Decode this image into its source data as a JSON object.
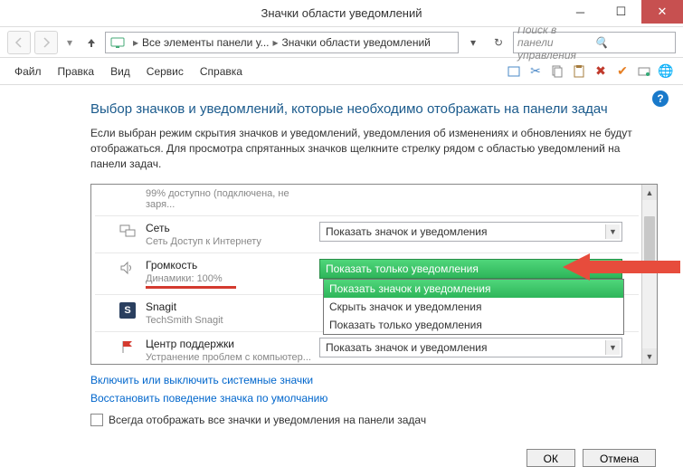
{
  "title": "Значки области уведомлений",
  "nav": {
    "breadcrumb": {
      "part1": "Все элементы панели у...",
      "part2": "Значки области уведомлений"
    },
    "search_placeholder": "Поиск в панели управления"
  },
  "menu": {
    "file": "Файл",
    "edit": "Правка",
    "view": "Вид",
    "service": "Сервис",
    "help": "Справка"
  },
  "heading": "Выбор значков и уведомлений, которые необходимо отображать на панели задач",
  "description": "Если выбран режим скрытия значков и уведомлений, уведомления об изменениях и обновлениях не будут отображаться. Для просмотра спрятанных значков щелкните стрелку рядом с областью уведомлений на панели задач.",
  "rows": {
    "r0_sub": "99% доступно (подключена, не заря...",
    "r1_title": "Сеть",
    "r1_sub": "Сеть Доступ к Интернету",
    "r1_combo": "Показать значок и уведомления",
    "r2_title": "Громкость",
    "r2_sub": "Динамики: 100%",
    "r2_combo": "Показать только уведомления",
    "r3_title": "Snagit",
    "r3_sub": "TechSmith Snagit",
    "r4_title": "Центр поддержки",
    "r4_sub": "Устранение проблем с компьютер...",
    "r4_combo": "Показать значок и уведомления"
  },
  "dropdown": {
    "opt1": "Показать значок и уведомления",
    "opt2": "Скрыть значок и уведомления",
    "opt3": "Показать только уведомления"
  },
  "links": {
    "l1": "Включить или выключить системные значки",
    "l2": "Восстановить поведение значка по умолчанию"
  },
  "checkbox_label": "Всегда отображать все значки и уведомления на панели задач",
  "buttons": {
    "ok": "ОК",
    "cancel": "Отмена"
  }
}
